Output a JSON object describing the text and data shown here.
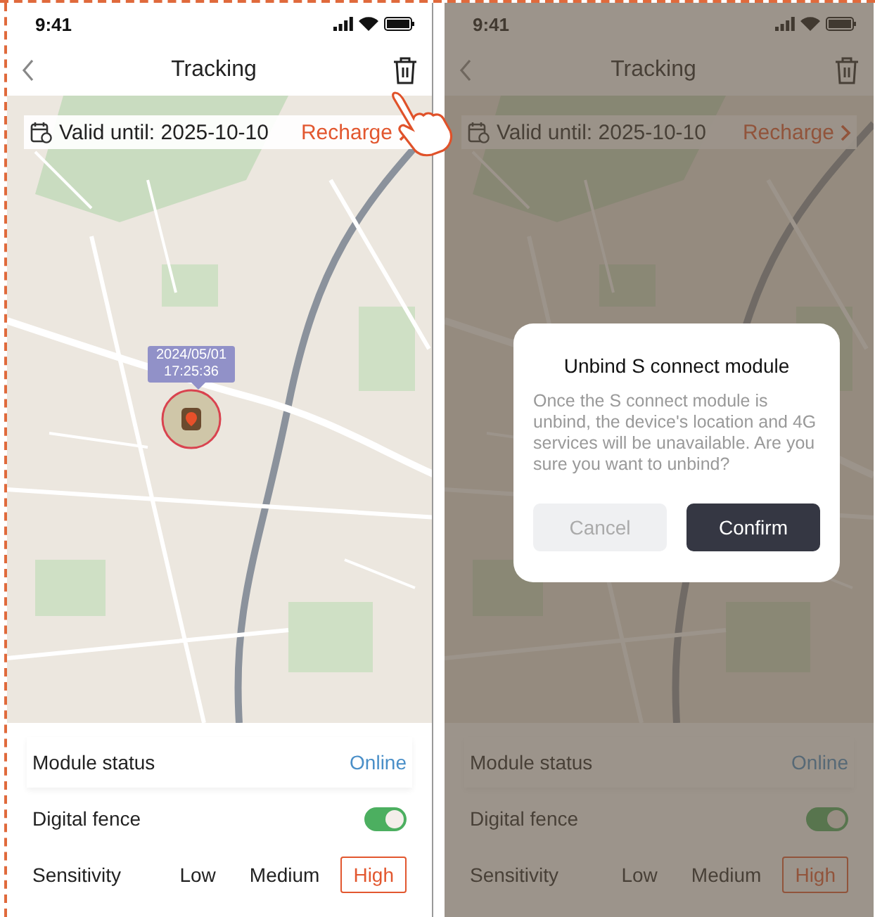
{
  "screens": [
    {
      "status_bar": {
        "time": "9:41"
      },
      "nav": {
        "title": "Tracking"
      },
      "validity": {
        "text": "Valid until: 2025-10-10",
        "action": "Recharge"
      },
      "touch_hint": true,
      "marker": {
        "date": "2024/05/01",
        "time": "17:25:36"
      },
      "settings": {
        "module_status": {
          "label": "Module status",
          "value": "Online"
        },
        "digital_fence": {
          "label": "Digital fence",
          "on": true
        },
        "sensitivity": {
          "label": "Sensitivity",
          "options": [
            {
              "label": "Low",
              "selected": false
            },
            {
              "label": "Medium",
              "selected": false
            },
            {
              "label": "High",
              "selected": true
            }
          ]
        }
      }
    },
    {
      "status_bar": {
        "time": "9:41"
      },
      "nav": {
        "title": "Tracking"
      },
      "validity": {
        "text": "Valid until: 2025-10-10",
        "action": "Recharge"
      },
      "touch_hint": false,
      "settings": {
        "module_status": {
          "label": "Module status",
          "value": "Online"
        },
        "digital_fence": {
          "label": "Digital fence",
          "on": true
        },
        "sensitivity": {
          "label": "Sensitivity",
          "options": [
            {
              "label": "Low",
              "selected": false
            },
            {
              "label": "Medium",
              "selected": false
            },
            {
              "label": "High",
              "selected": true
            }
          ]
        }
      },
      "dialog": {
        "title": "Unbind S connect module",
        "message": "Once the S connect module is unbind, the device's location and 4G services will be unavailable. Are you sure you want to unbind?",
        "buttons": [
          {
            "label": "Cancel",
            "kind": "secondary"
          },
          {
            "label": "Confirm",
            "kind": "primary"
          }
        ]
      }
    }
  ]
}
